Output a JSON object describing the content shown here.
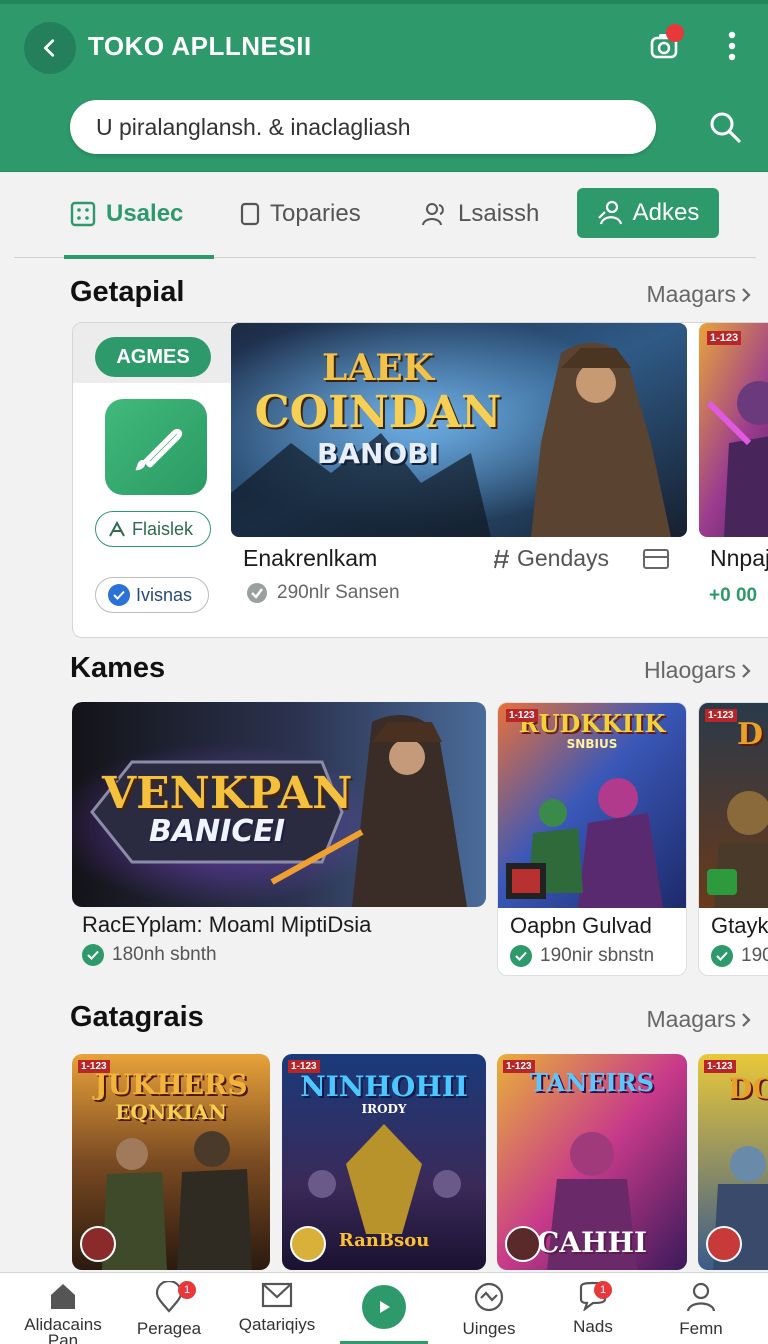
{
  "header": {
    "title": "TOKO APLLNESII",
    "search_placeholder": "U piralanglansh. & inaclagliash"
  },
  "tabs": [
    {
      "label": "Usalec",
      "icon": "grid-icon",
      "active": true
    },
    {
      "label": "Toparies",
      "icon": "square-icon",
      "active": false
    },
    {
      "label": "Lsaissh",
      "icon": "people-icon",
      "active": false
    },
    {
      "label": "Adkes",
      "icon": "person-icon",
      "active": false
    }
  ],
  "section1": {
    "title": "Getapial",
    "more": "Maagars",
    "badge": "AGMES",
    "pill_green": "Flaislek",
    "pill_grey": "Ivisnas",
    "banner_line1": "LAEK",
    "banner_line2": "COINDAN",
    "banner_line3": "BANOBI",
    "item_title": "Enakrenlkam",
    "item_sub": "290nlr Sansen",
    "item_cat": "Gendays",
    "side_title": "Nnpaj",
    "side_sub": "+0 00",
    "side_tag": "1-123"
  },
  "section2": {
    "title": "Kames",
    "more": "Hlaogars",
    "cards": [
      {
        "art1": "VENKPAN",
        "art2": "BANICEI",
        "title": "RacEYplam: Moaml MiptiDsia",
        "sub": "180nh sbnth"
      },
      {
        "art1": "RUDKKIIK",
        "art2": "SNBIUS",
        "tag": "1-123",
        "title": "Oapbn Gulvad",
        "sub": "190nir sbnstn"
      },
      {
        "art1": "D",
        "tag": "1-123",
        "title": "Gtaykc",
        "sub": "190"
      }
    ]
  },
  "section3": {
    "title": "Gatagrais",
    "more": "Maagars",
    "cards": [
      {
        "art1": "JUKHERS",
        "art2": "EQNKIAN",
        "tag": "1-123"
      },
      {
        "art1": "NINHOHII",
        "art2": "IRODY",
        "art3": "RanBsou",
        "tag": "1-123"
      },
      {
        "art1": "TANEIRS",
        "art2": "CAHHI",
        "tag": "1-123"
      },
      {
        "art1": "DO",
        "tag": "1-123"
      }
    ]
  },
  "bottom_nav": [
    {
      "label": "Alidacains\nPan",
      "icon": "home-icon"
    },
    {
      "label": "Peragea",
      "icon": "location-icon",
      "badge": "1"
    },
    {
      "label": "Qatariqiys",
      "icon": "mail-icon"
    },
    {
      "label": "",
      "icon": "play-icon"
    },
    {
      "label": "Uinges",
      "icon": "heart-icon"
    },
    {
      "label": "Nads",
      "icon": "chat-icon",
      "badge": "1"
    },
    {
      "label": "Femn",
      "icon": "profile-icon"
    }
  ],
  "colors": {
    "primary": "#2e9a6c",
    "notification": "#e8383b",
    "background": "#f1f2f1"
  }
}
